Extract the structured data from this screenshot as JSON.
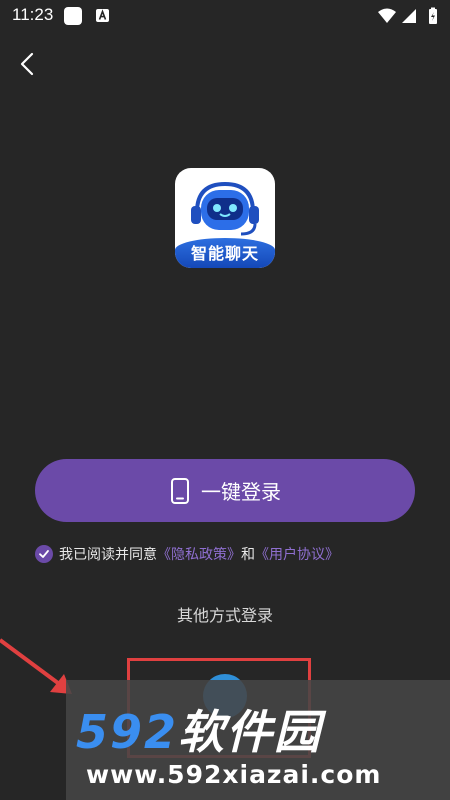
{
  "status_bar": {
    "time": "11:23"
  },
  "app": {
    "logo_text": "智能聊天"
  },
  "login": {
    "one_click_label": "一键登录"
  },
  "agreement": {
    "prefix": "我已阅读并同意",
    "privacy_link": "《隐私政策》",
    "conjunction": "和",
    "user_link": "《用户协议》"
  },
  "other_login": {
    "label": "其他方式登录"
  },
  "watermark": {
    "number": "592",
    "name": "软件园",
    "url": "www.592xiazai.com"
  },
  "colors": {
    "background": "#262626",
    "accent": "#6b4aa8",
    "link": "#8f6fd0",
    "highlight": "#e04040"
  }
}
